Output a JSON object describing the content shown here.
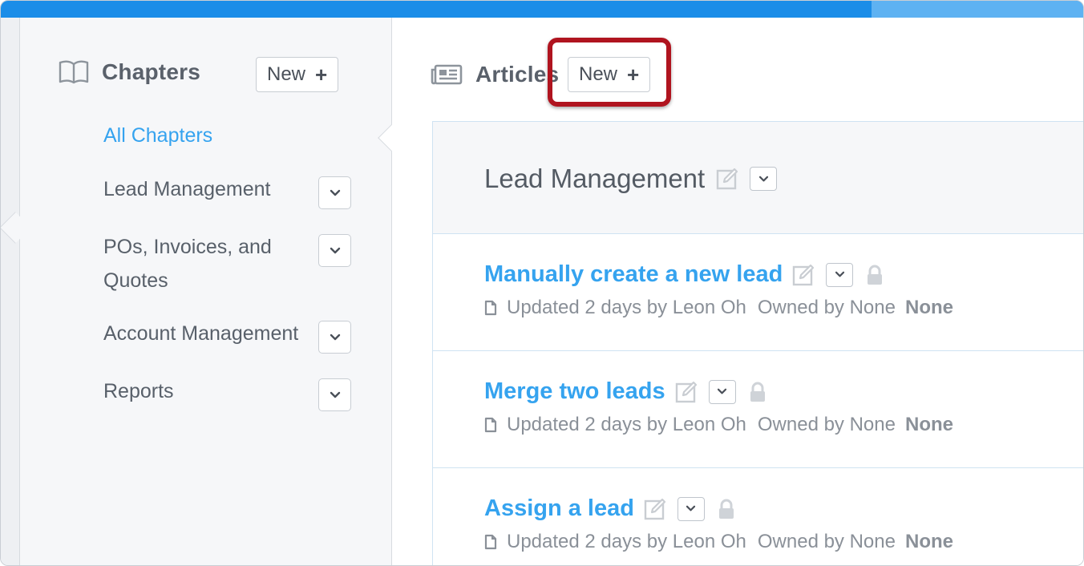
{
  "sidebar": {
    "title": "Chapters",
    "new_button": "New",
    "chapters": [
      {
        "label": "All Chapters",
        "active": true
      },
      {
        "label": "Lead Management"
      },
      {
        "label": "POs, Invoices, and Quotes"
      },
      {
        "label": "Account Management"
      },
      {
        "label": "Reports"
      }
    ]
  },
  "main": {
    "title": "Articles",
    "new_button": "New",
    "chapter_name": "Lead Management",
    "articles": [
      {
        "title": "Manually create a new lead",
        "updated": "Updated 2 days by Leon Oh",
        "owned": "Owned by None",
        "owner": "None"
      },
      {
        "title": "Merge two leads",
        "updated": "Updated 2 days by Leon Oh",
        "owned": "Owned by None",
        "owner": "None"
      },
      {
        "title": "Assign a lead",
        "updated": "Updated 2 days by Leon Oh",
        "owned": "Owned by None",
        "owner": "None"
      }
    ]
  },
  "colors": {
    "accent": "#35a3ef",
    "topbar": "#1b8de8",
    "highlight": "#b0141f"
  },
  "icons": [
    "book-icon",
    "newspaper-icon",
    "plus-icon",
    "chevron-down-icon",
    "edit-icon",
    "lock-icon",
    "document-icon"
  ]
}
